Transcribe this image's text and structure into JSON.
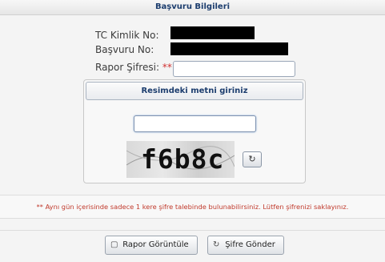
{
  "header": {
    "title": "Başvuru Bilgileri"
  },
  "form": {
    "tc_label": "TC Kimlik No:",
    "basvuru_label": "Başvuru No:",
    "rapor_label": "Rapor Şifresi:",
    "required_mark": "**",
    "password_value": ""
  },
  "captcha": {
    "title": "Resimdeki metni giriniz",
    "input_value": "",
    "image_text": "f6b8c"
  },
  "notice": "** Aynı gün içerisinde sadece 1 kere şifre talebinde bulunabilirsiniz. Lütfen şifrenizi saklayınız.",
  "buttons": {
    "view_report": "Rapor Görüntüle",
    "send_password": "Şifre Gönder"
  },
  "icons": {
    "document": "document-icon",
    "refresh": "refresh-icon"
  }
}
